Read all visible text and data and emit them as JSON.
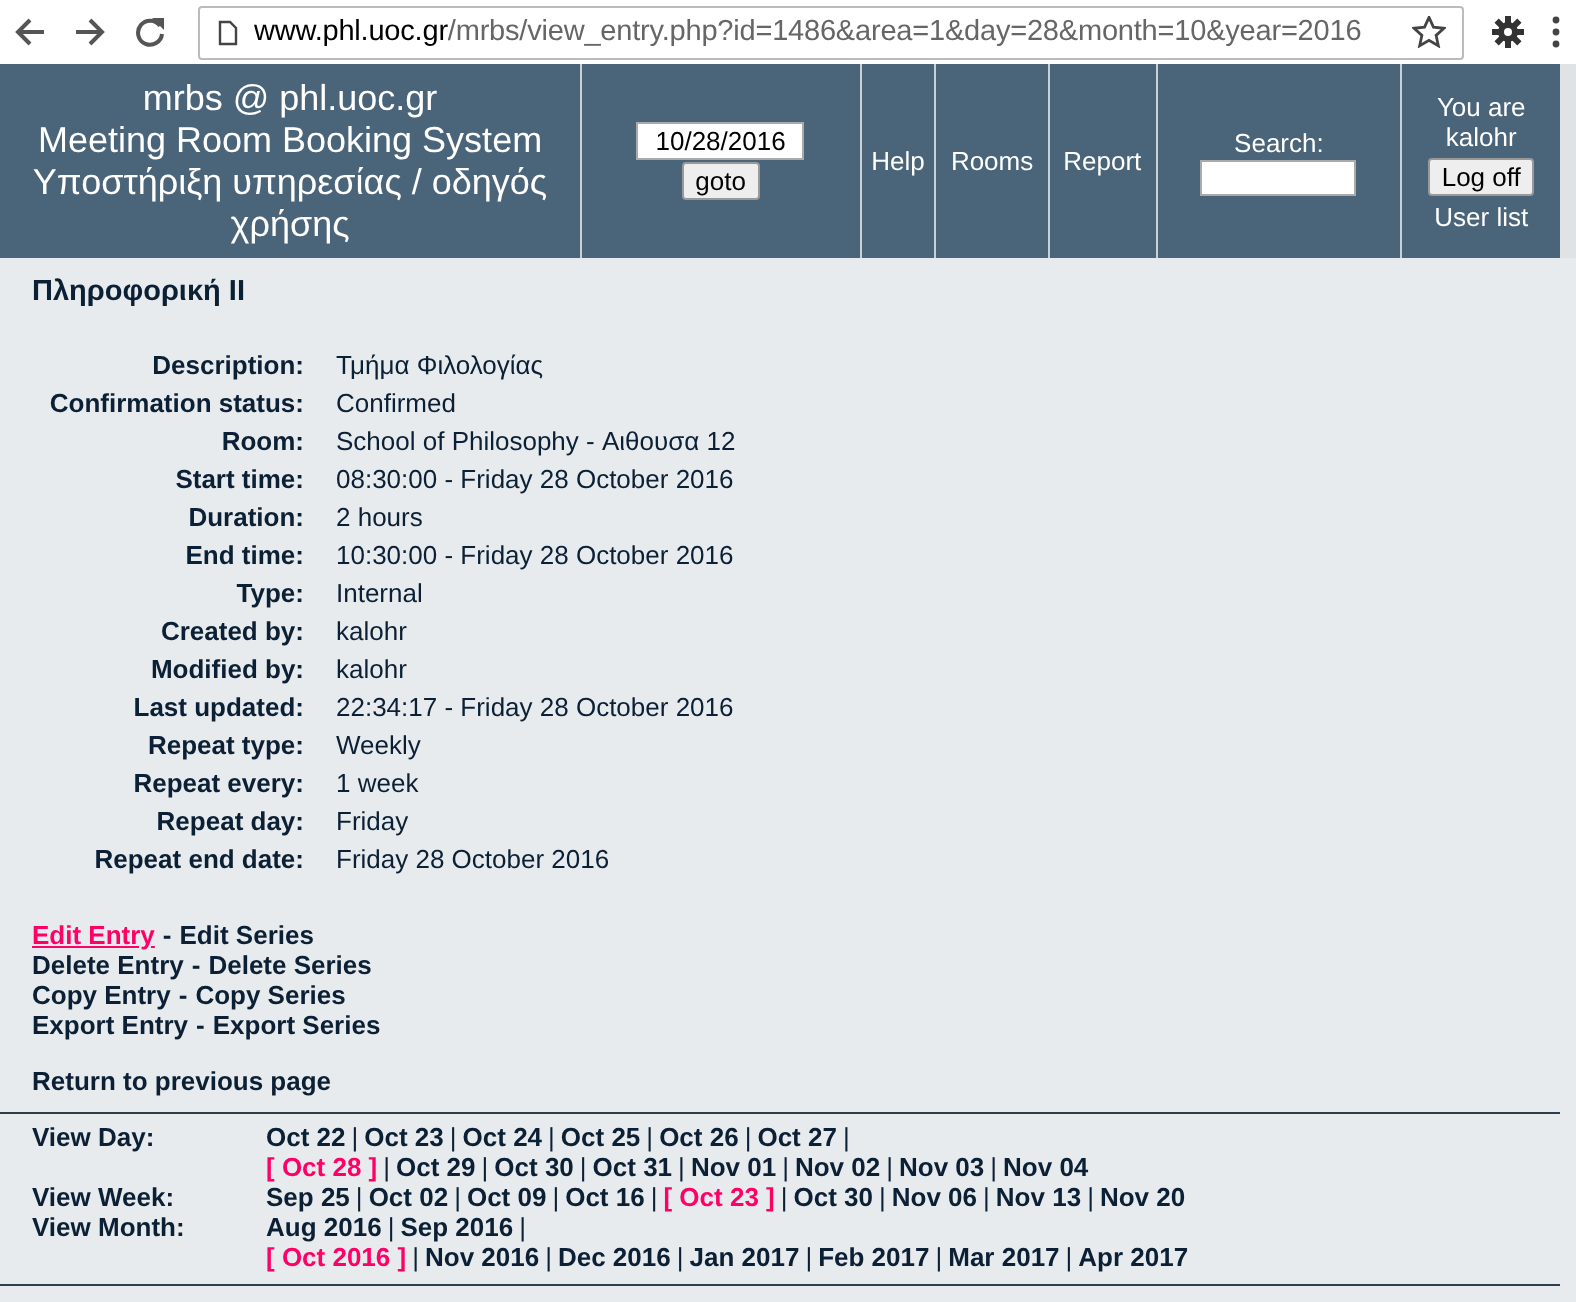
{
  "browser": {
    "url_host": "www.phl.uoc.gr",
    "url_path": "/mrbs/view_entry.php?id=1486&area=1&day=28&month=10&year=2016"
  },
  "header": {
    "title_lines": [
      "mrbs @ phl.uoc.gr",
      "Meeting Room Booking System",
      "Υποστήριξη υπηρεσίας / οδηγός χρήσης"
    ],
    "date_value": "10/28/2016",
    "goto_button": "goto",
    "links": [
      "Help",
      "Rooms",
      "Report"
    ],
    "search_label": "Search:",
    "user_text": "You are kalohr",
    "logoff_button": "Log off",
    "user_list_link": "User list"
  },
  "entry": {
    "title": "Πληροφορική II",
    "details": [
      {
        "label": "Description:",
        "value": "Τμήμα Φιλολογίας"
      },
      {
        "label": "Confirmation status:",
        "value": "Confirmed"
      },
      {
        "label": "Room:",
        "value": "School of Philosophy - Αιθουσα 12"
      },
      {
        "label": "Start time:",
        "value": "08:30:00 - Friday 28 October 2016"
      },
      {
        "label": "Duration:",
        "value": "2 hours"
      },
      {
        "label": "End time:",
        "value": "10:30:00 - Friday 28 October 2016"
      },
      {
        "label": "Type:",
        "value": "Internal"
      },
      {
        "label": "Created by:",
        "value": "kalohr"
      },
      {
        "label": "Modified by:",
        "value": "kalohr"
      },
      {
        "label": "Last updated:",
        "value": "22:34:17 - Friday 28 October 2016"
      },
      {
        "label": "Repeat type:",
        "value": "Weekly"
      },
      {
        "label": "Repeat every:",
        "value": "1 week"
      },
      {
        "label": "Repeat day:",
        "value": "Friday"
      },
      {
        "label": "Repeat end date:",
        "value": "Friday 28 October 2016"
      }
    ],
    "action_separator": "-",
    "actions": [
      {
        "entry": {
          "label": "Edit Entry",
          "selected": true
        },
        "series": {
          "label": "Edit Series",
          "selected": false
        }
      },
      {
        "entry": {
          "label": "Delete Entry",
          "selected": false
        },
        "series": {
          "label": "Delete Series",
          "selected": false
        }
      },
      {
        "entry": {
          "label": "Copy Entry",
          "selected": false
        },
        "series": {
          "label": "Copy Series",
          "selected": false
        }
      },
      {
        "entry": {
          "label": "Export Entry",
          "selected": false
        },
        "series": {
          "label": "Export Series",
          "selected": false
        }
      }
    ],
    "return_link": "Return to previous page"
  },
  "nav": {
    "separator": "|",
    "rows": [
      {
        "label": "View Day:",
        "items": [
          {
            "label": "Oct 22",
            "selected": false
          },
          {
            "label": "Oct 23",
            "selected": false
          },
          {
            "label": "Oct 24",
            "selected": false
          },
          {
            "label": "Oct 25",
            "selected": false
          },
          {
            "label": "Oct 26",
            "selected": false
          },
          {
            "label": "Oct 27",
            "selected": false
          },
          {
            "label": "[ Oct 28 ]",
            "selected": true
          },
          {
            "label": "Oct 29",
            "selected": false
          },
          {
            "label": "Oct 30",
            "selected": false
          },
          {
            "label": "Oct 31",
            "selected": false
          },
          {
            "label": "Nov 01",
            "selected": false
          },
          {
            "label": "Nov 02",
            "selected": false
          },
          {
            "label": "Nov 03",
            "selected": false
          },
          {
            "label": "Nov 04",
            "selected": false
          }
        ]
      },
      {
        "label": "View Week:",
        "items": [
          {
            "label": "Sep 25",
            "selected": false
          },
          {
            "label": "Oct 02",
            "selected": false
          },
          {
            "label": "Oct 09",
            "selected": false
          },
          {
            "label": "Oct 16",
            "selected": false
          },
          {
            "label": "[ Oct 23 ]",
            "selected": true
          },
          {
            "label": "Oct 30",
            "selected": false
          },
          {
            "label": "Nov 06",
            "selected": false
          },
          {
            "label": "Nov 13",
            "selected": false
          },
          {
            "label": "Nov 20",
            "selected": false
          }
        ]
      },
      {
        "label": "View Month:",
        "items": [
          {
            "label": "Aug 2016",
            "selected": false
          },
          {
            "label": "Sep 2016",
            "selected": false
          },
          {
            "label": "[ Oct 2016 ]",
            "selected": true
          },
          {
            "label": "Nov 2016",
            "selected": false
          },
          {
            "label": "Dec 2016",
            "selected": false
          },
          {
            "label": "Jan 2017",
            "selected": false
          },
          {
            "label": "Feb 2017",
            "selected": false
          },
          {
            "label": "Mar 2017",
            "selected": false
          },
          {
            "label": "Apr 2017",
            "selected": false
          }
        ]
      }
    ]
  }
}
